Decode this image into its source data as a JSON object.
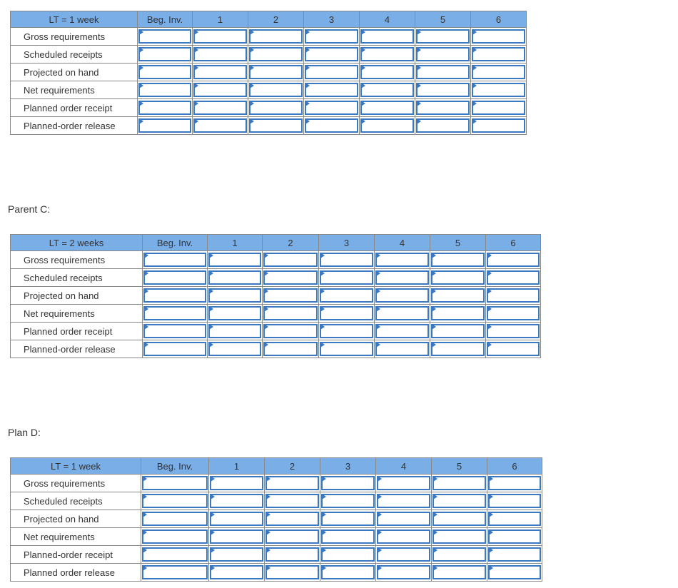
{
  "tables": [
    {
      "title": "",
      "lead": "LT = 1 week",
      "beg": "Beg. Inv.",
      "periods": [
        "1",
        "2",
        "3",
        "4",
        "5",
        "6"
      ],
      "rows": [
        "Gross requirements",
        "Scheduled receipts",
        "Projected on hand",
        "Net requirements",
        "Planned order receipt",
        "Planned-order release"
      ]
    },
    {
      "title": "Parent C:",
      "lead": "LT = 2 weeks",
      "beg": "Beg. Inv.",
      "periods": [
        "1",
        "2",
        "3",
        "4",
        "5",
        "6"
      ],
      "rows": [
        "Gross requirements",
        "Scheduled receipts",
        "Projected on hand",
        "Net requirements",
        "Planned order receipt",
        "Planned-order release"
      ]
    },
    {
      "title": "Plan D:",
      "lead": "LT = 1 week",
      "beg": "Beg. Inv.",
      "periods": [
        "1",
        "2",
        "3",
        "4",
        "5",
        "6"
      ],
      "rows": [
        "Gross requirements",
        "Scheduled receipts",
        "Projected on hand",
        "Net requirements",
        "Planned-order receipt",
        "Planned order release"
      ]
    }
  ],
  "colors": {
    "header": "#7aaee6",
    "input_border": "#3b78c2"
  }
}
